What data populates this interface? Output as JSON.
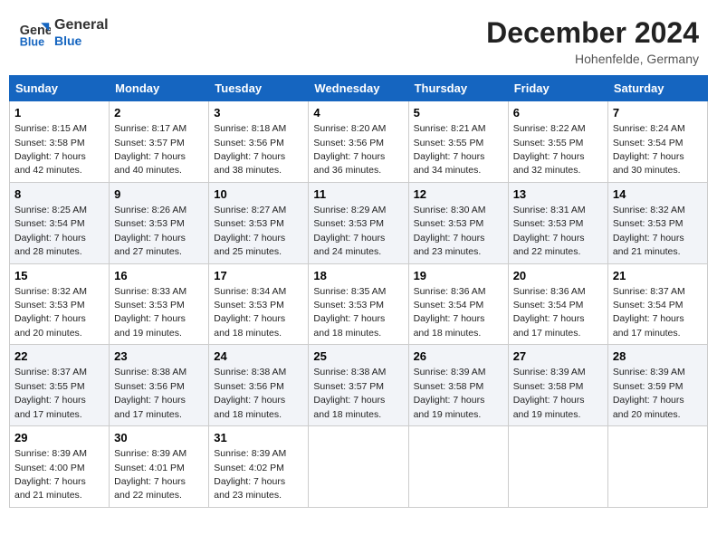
{
  "header": {
    "logo_line1": "General",
    "logo_line2": "Blue",
    "month": "December 2024",
    "location": "Hohenfelde, Germany"
  },
  "days_of_week": [
    "Sunday",
    "Monday",
    "Tuesday",
    "Wednesday",
    "Thursday",
    "Friday",
    "Saturday"
  ],
  "weeks": [
    [
      {
        "day": "1",
        "sunrise": "Sunrise: 8:15 AM",
        "sunset": "Sunset: 3:58 PM",
        "daylight": "Daylight: 7 hours and 42 minutes."
      },
      {
        "day": "2",
        "sunrise": "Sunrise: 8:17 AM",
        "sunset": "Sunset: 3:57 PM",
        "daylight": "Daylight: 7 hours and 40 minutes."
      },
      {
        "day": "3",
        "sunrise": "Sunrise: 8:18 AM",
        "sunset": "Sunset: 3:56 PM",
        "daylight": "Daylight: 7 hours and 38 minutes."
      },
      {
        "day": "4",
        "sunrise": "Sunrise: 8:20 AM",
        "sunset": "Sunset: 3:56 PM",
        "daylight": "Daylight: 7 hours and 36 minutes."
      },
      {
        "day": "5",
        "sunrise": "Sunrise: 8:21 AM",
        "sunset": "Sunset: 3:55 PM",
        "daylight": "Daylight: 7 hours and 34 minutes."
      },
      {
        "day": "6",
        "sunrise": "Sunrise: 8:22 AM",
        "sunset": "Sunset: 3:55 PM",
        "daylight": "Daylight: 7 hours and 32 minutes."
      },
      {
        "day": "7",
        "sunrise": "Sunrise: 8:24 AM",
        "sunset": "Sunset: 3:54 PM",
        "daylight": "Daylight: 7 hours and 30 minutes."
      }
    ],
    [
      {
        "day": "8",
        "sunrise": "Sunrise: 8:25 AM",
        "sunset": "Sunset: 3:54 PM",
        "daylight": "Daylight: 7 hours and 28 minutes."
      },
      {
        "day": "9",
        "sunrise": "Sunrise: 8:26 AM",
        "sunset": "Sunset: 3:53 PM",
        "daylight": "Daylight: 7 hours and 27 minutes."
      },
      {
        "day": "10",
        "sunrise": "Sunrise: 8:27 AM",
        "sunset": "Sunset: 3:53 PM",
        "daylight": "Daylight: 7 hours and 25 minutes."
      },
      {
        "day": "11",
        "sunrise": "Sunrise: 8:29 AM",
        "sunset": "Sunset: 3:53 PM",
        "daylight": "Daylight: 7 hours and 24 minutes."
      },
      {
        "day": "12",
        "sunrise": "Sunrise: 8:30 AM",
        "sunset": "Sunset: 3:53 PM",
        "daylight": "Daylight: 7 hours and 23 minutes."
      },
      {
        "day": "13",
        "sunrise": "Sunrise: 8:31 AM",
        "sunset": "Sunset: 3:53 PM",
        "daylight": "Daylight: 7 hours and 22 minutes."
      },
      {
        "day": "14",
        "sunrise": "Sunrise: 8:32 AM",
        "sunset": "Sunset: 3:53 PM",
        "daylight": "Daylight: 7 hours and 21 minutes."
      }
    ],
    [
      {
        "day": "15",
        "sunrise": "Sunrise: 8:32 AM",
        "sunset": "Sunset: 3:53 PM",
        "daylight": "Daylight: 7 hours and 20 minutes."
      },
      {
        "day": "16",
        "sunrise": "Sunrise: 8:33 AM",
        "sunset": "Sunset: 3:53 PM",
        "daylight": "Daylight: 7 hours and 19 minutes."
      },
      {
        "day": "17",
        "sunrise": "Sunrise: 8:34 AM",
        "sunset": "Sunset: 3:53 PM",
        "daylight": "Daylight: 7 hours and 18 minutes."
      },
      {
        "day": "18",
        "sunrise": "Sunrise: 8:35 AM",
        "sunset": "Sunset: 3:53 PM",
        "daylight": "Daylight: 7 hours and 18 minutes."
      },
      {
        "day": "19",
        "sunrise": "Sunrise: 8:36 AM",
        "sunset": "Sunset: 3:54 PM",
        "daylight": "Daylight: 7 hours and 18 minutes."
      },
      {
        "day": "20",
        "sunrise": "Sunrise: 8:36 AM",
        "sunset": "Sunset: 3:54 PM",
        "daylight": "Daylight: 7 hours and 17 minutes."
      },
      {
        "day": "21",
        "sunrise": "Sunrise: 8:37 AM",
        "sunset": "Sunset: 3:54 PM",
        "daylight": "Daylight: 7 hours and 17 minutes."
      }
    ],
    [
      {
        "day": "22",
        "sunrise": "Sunrise: 8:37 AM",
        "sunset": "Sunset: 3:55 PM",
        "daylight": "Daylight: 7 hours and 17 minutes."
      },
      {
        "day": "23",
        "sunrise": "Sunrise: 8:38 AM",
        "sunset": "Sunset: 3:56 PM",
        "daylight": "Daylight: 7 hours and 17 minutes."
      },
      {
        "day": "24",
        "sunrise": "Sunrise: 8:38 AM",
        "sunset": "Sunset: 3:56 PM",
        "daylight": "Daylight: 7 hours and 18 minutes."
      },
      {
        "day": "25",
        "sunrise": "Sunrise: 8:38 AM",
        "sunset": "Sunset: 3:57 PM",
        "daylight": "Daylight: 7 hours and 18 minutes."
      },
      {
        "day": "26",
        "sunrise": "Sunrise: 8:39 AM",
        "sunset": "Sunset: 3:58 PM",
        "daylight": "Daylight: 7 hours and 19 minutes."
      },
      {
        "day": "27",
        "sunrise": "Sunrise: 8:39 AM",
        "sunset": "Sunset: 3:58 PM",
        "daylight": "Daylight: 7 hours and 19 minutes."
      },
      {
        "day": "28",
        "sunrise": "Sunrise: 8:39 AM",
        "sunset": "Sunset: 3:59 PM",
        "daylight": "Daylight: 7 hours and 20 minutes."
      }
    ],
    [
      {
        "day": "29",
        "sunrise": "Sunrise: 8:39 AM",
        "sunset": "Sunset: 4:00 PM",
        "daylight": "Daylight: 7 hours and 21 minutes."
      },
      {
        "day": "30",
        "sunrise": "Sunrise: 8:39 AM",
        "sunset": "Sunset: 4:01 PM",
        "daylight": "Daylight: 7 hours and 22 minutes."
      },
      {
        "day": "31",
        "sunrise": "Sunrise: 8:39 AM",
        "sunset": "Sunset: 4:02 PM",
        "daylight": "Daylight: 7 hours and 23 minutes."
      },
      null,
      null,
      null,
      null
    ]
  ]
}
